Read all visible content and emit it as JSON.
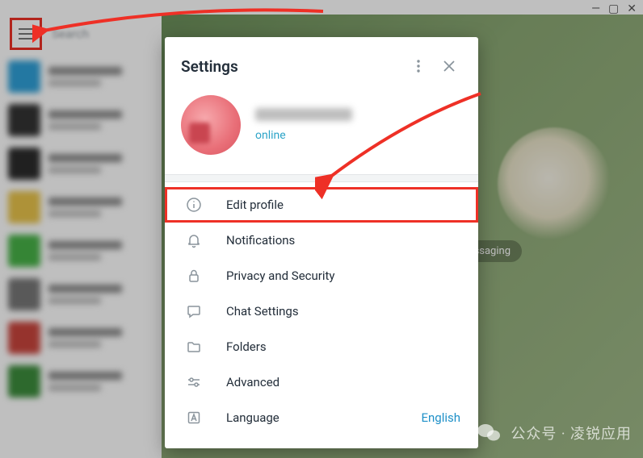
{
  "window": {
    "minimize": "—",
    "maximize": "▢",
    "close": "✕"
  },
  "topbar": {
    "search_placeholder": "Search"
  },
  "main": {
    "badge_text": "ssaging"
  },
  "settings": {
    "title": "Settings",
    "status": "online",
    "menu": [
      {
        "label": "Edit profile"
      },
      {
        "label": "Notifications"
      },
      {
        "label": "Privacy and Security"
      },
      {
        "label": "Chat Settings"
      },
      {
        "label": "Folders"
      },
      {
        "label": "Advanced"
      },
      {
        "label": "Language",
        "value": "English"
      }
    ]
  },
  "watermark": {
    "text": "公众号 · 凌锐应用"
  },
  "colors": {
    "highlight": "#ee3026",
    "link": "#1e90c8",
    "status": "#2da4c8"
  }
}
